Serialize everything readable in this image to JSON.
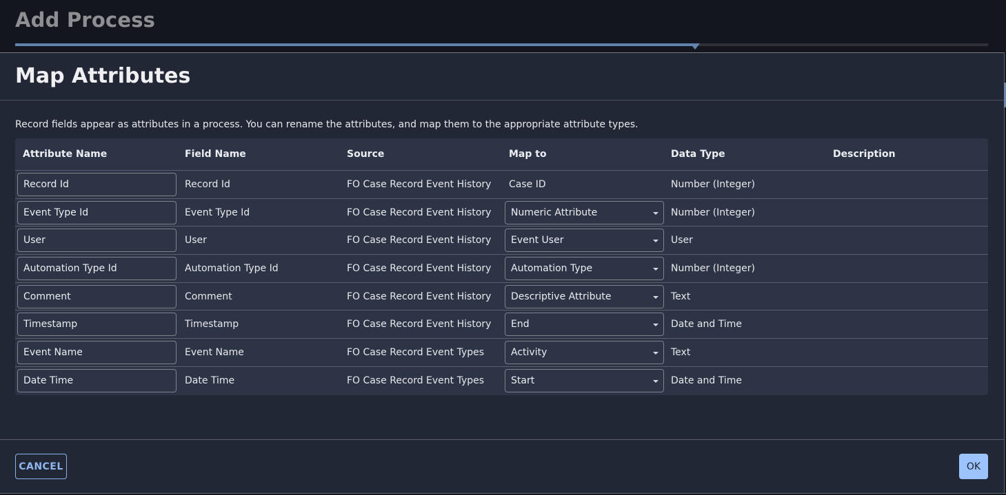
{
  "app": {
    "title": "Add Process",
    "wizard_progress_fraction": 0.699
  },
  "dialog": {
    "title": "Map Attributes",
    "description": "Record fields appear as attributes in a process. You can rename the attributes, and map them to the appropriate attribute types.",
    "table": {
      "columns": [
        "Attribute Name",
        "Field Name",
        "Source",
        "Map to",
        "Data Type",
        "Description"
      ],
      "rows": [
        {
          "attribute_name": "Record Id",
          "field_name": "Record Id",
          "source": "FO Case Record Event History",
          "map_to": "Case ID",
          "map_to_editable": false,
          "data_type": "Number (Integer)",
          "description": ""
        },
        {
          "attribute_name": "Event Type Id",
          "field_name": "Event Type Id",
          "source": "FO Case Record Event History",
          "map_to": "Numeric Attribute",
          "map_to_editable": true,
          "data_type": "Number (Integer)",
          "description": ""
        },
        {
          "attribute_name": "User",
          "field_name": "User",
          "source": "FO Case Record Event History",
          "map_to": "Event User",
          "map_to_editable": true,
          "data_type": "User",
          "description": ""
        },
        {
          "attribute_name": "Automation Type Id",
          "field_name": "Automation Type Id",
          "source": "FO Case Record Event History",
          "map_to": "Automation Type",
          "map_to_editable": true,
          "data_type": "Number (Integer)",
          "description": ""
        },
        {
          "attribute_name": "Comment",
          "field_name": "Comment",
          "source": "FO Case Record Event History",
          "map_to": "Descriptive Attribute",
          "map_to_editable": true,
          "data_type": "Text",
          "description": ""
        },
        {
          "attribute_name": "Timestamp",
          "field_name": "Timestamp",
          "source": "FO Case Record Event History",
          "map_to": "End",
          "map_to_editable": true,
          "data_type": "Date and Time",
          "description": ""
        },
        {
          "attribute_name": "Event Name",
          "field_name": "Event Name",
          "source": "FO Case Record Event Types",
          "map_to": "Activity",
          "map_to_editable": true,
          "data_type": "Text",
          "description": ""
        },
        {
          "attribute_name": "Date Time",
          "field_name": "Date Time",
          "source": "FO Case Record Event Types",
          "map_to": "Start",
          "map_to_editable": true,
          "data_type": "Date and Time",
          "description": ""
        }
      ]
    },
    "footer": {
      "cancel_label": "CANCEL",
      "ok_label": "OK"
    }
  },
  "colors": {
    "accent": "#9cc3fb",
    "progress": "#6283ad",
    "dialog_bg": "#222735",
    "table_bg": "#2c3445"
  }
}
